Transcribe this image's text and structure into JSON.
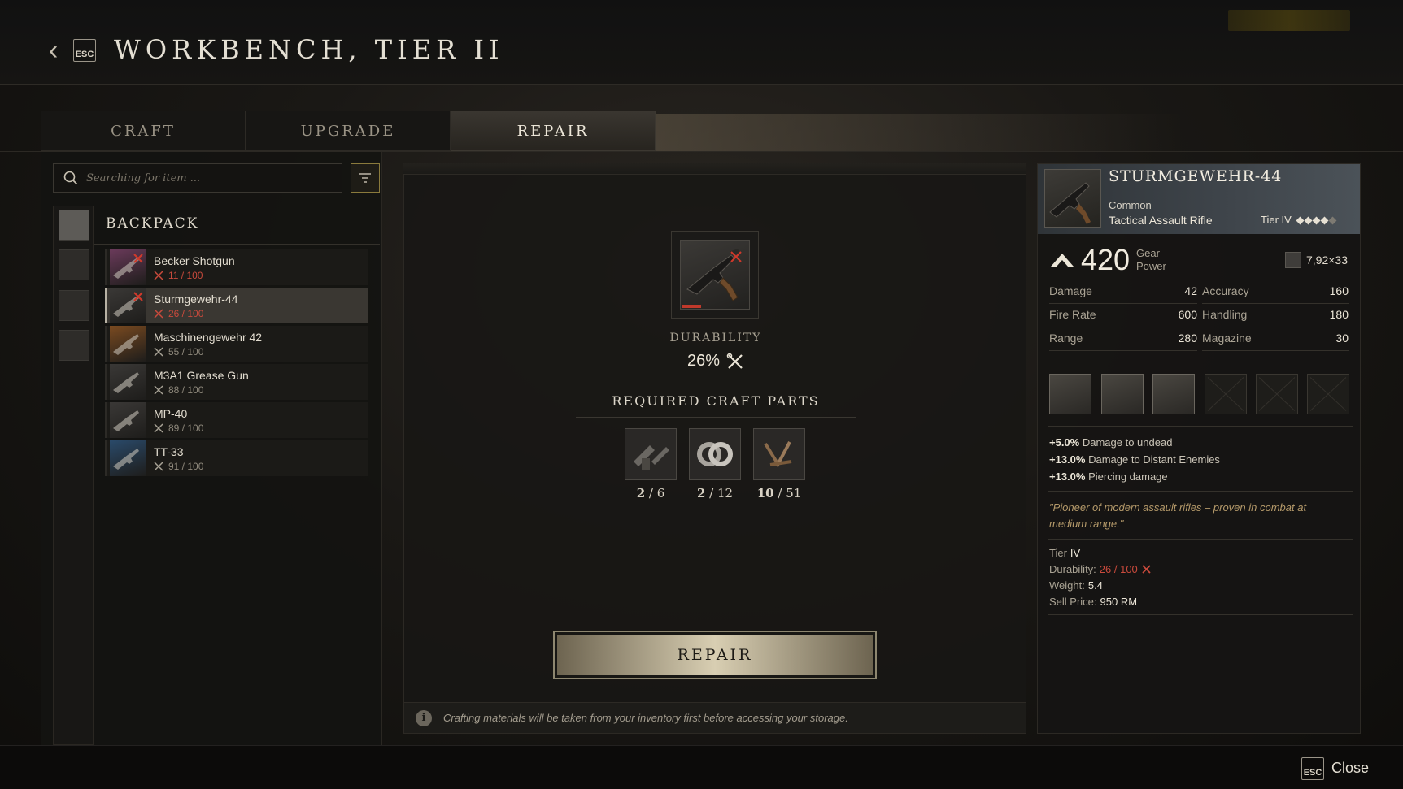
{
  "header": {
    "title": "WORKBENCH, TIER II",
    "back_key": "ESC"
  },
  "tabs": [
    {
      "label": "CRAFT",
      "active": false
    },
    {
      "label": "UPGRADE",
      "active": false
    },
    {
      "label": "REPAIR",
      "active": true
    }
  ],
  "search": {
    "placeholder": "Searching for item ...",
    "icon": "search-icon"
  },
  "backpack": {
    "title": "BACKPACK",
    "items": [
      {
        "name": "Becker Shotgun",
        "durability": "11 / 100",
        "low": true,
        "selected": false
      },
      {
        "name": "Sturmgewehr-44",
        "durability": "26 / 100",
        "low": true,
        "selected": true
      },
      {
        "name": "Maschinengewehr 42",
        "durability": "55 / 100",
        "low": false,
        "selected": false
      },
      {
        "name": "M3A1 Grease Gun",
        "durability": "88 / 100",
        "low": false,
        "selected": false
      },
      {
        "name": "MP-40",
        "durability": "89 / 100",
        "low": false,
        "selected": false
      },
      {
        "name": "TT-33",
        "durability": "91 / 100",
        "low": false,
        "selected": false
      }
    ]
  },
  "repair": {
    "durability_label": "DURABILITY",
    "durability_value": "26%",
    "durability_fraction": 0.26,
    "required_label": "REQUIRED CRAFT PARTS",
    "parts": [
      {
        "have": "2",
        "need": "6",
        "icon": "gun-parts-icon"
      },
      {
        "have": "2",
        "need": "12",
        "icon": "rings-icon"
      },
      {
        "have": "10",
        "need": "51",
        "icon": "screws-icon"
      }
    ],
    "button_label": "REPAIR",
    "info_text": "Crafting materials will be taken from your inventory first before accessing your storage."
  },
  "details": {
    "name": "STURMGEWEHR-44",
    "rarity": "Common",
    "type": "Tactical Assault Rifle",
    "tier_label": "Tier IV",
    "tier_filled": 4,
    "tier_total": 5,
    "gear_power": "420",
    "gear_power_label_1": "Gear",
    "gear_power_label_2": "Power",
    "ammo": "7,92×33",
    "stats": [
      {
        "label": "Damage",
        "value": "42"
      },
      {
        "label": "Accuracy",
        "value": "160"
      },
      {
        "label": "Fire Rate",
        "value": "600"
      },
      {
        "label": "Handling",
        "value": "180"
      },
      {
        "label": "Range",
        "value": "280"
      },
      {
        "label": "Magazine",
        "value": "30"
      }
    ],
    "bonuses": [
      {
        "value": "+5.0%",
        "text": "Damage to undead"
      },
      {
        "value": "+13.0%",
        "text": "Damage to Distant Enemies"
      },
      {
        "value": "+13.0%",
        "text": "Piercing damage"
      }
    ],
    "flavor": "\"Pioneer of modern assault rifles – proven in combat at medium range.\"",
    "tier_key": "Tier",
    "tier_value": "IV",
    "durability_key": "Durability:",
    "durability_value": "26 / 100",
    "weight_key": "Weight:",
    "weight_value": "5.4",
    "price_key": "Sell Price:",
    "price_value": "950 RM"
  },
  "footer": {
    "close_key": "ESC",
    "close_label": "Close"
  },
  "colors": {
    "accent_gold": "#8a7a3c",
    "low_durability": "#c94a3c",
    "header_panel": "#3f454b"
  }
}
